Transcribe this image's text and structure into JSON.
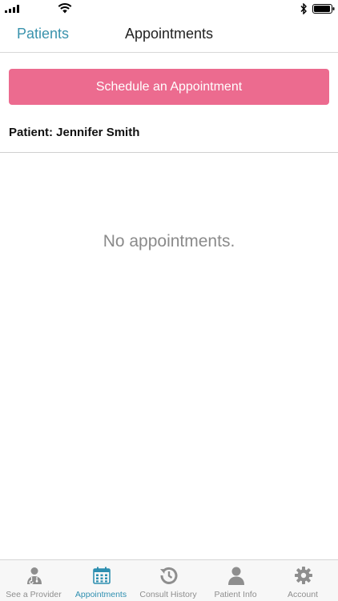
{
  "nav": {
    "back_label": "Patients",
    "title": "Appointments"
  },
  "actions": {
    "schedule_label": "Schedule an Appointment"
  },
  "patient": {
    "label": "Patient: Jennifer Smith"
  },
  "empty_state": {
    "message": "No appointments."
  },
  "tabs": [
    {
      "label": "See a Provider",
      "icon": "doctor-icon",
      "active": false
    },
    {
      "label": "Appointments",
      "icon": "calendar-icon",
      "active": true
    },
    {
      "label": "Consult History",
      "icon": "history-icon",
      "active": false
    },
    {
      "label": "Patient Info",
      "icon": "person-icon",
      "active": false
    },
    {
      "label": "Account",
      "icon": "gear-icon",
      "active": false
    }
  ],
  "colors": {
    "accent": "#3a93ad",
    "button": "#ec6b8f",
    "active_tab": "#2e8fb0",
    "inactive_tab": "#8e8e8e"
  }
}
